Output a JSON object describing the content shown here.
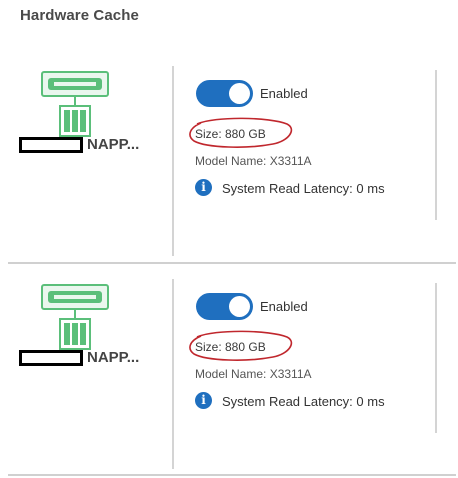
{
  "page": {
    "title": "Hardware Cache"
  },
  "colors": {
    "accent": "#1f6fbf",
    "node_green": "#5bbf7a",
    "annotation_red": "#c0272d"
  },
  "cards": [
    {
      "node_name": "NAPP...",
      "toggle_state": "on",
      "toggle_label": "Enabled",
      "size": "Size: 880 GB",
      "model": "Model Name: X3311A",
      "latency": "System Read Latency: 0 ms",
      "icons": {
        "node": "storage-node-icon",
        "info": "info-icon"
      }
    },
    {
      "node_name": "NAPP...",
      "toggle_state": "on",
      "toggle_label": "Enabled",
      "size": "Size: 880 GB",
      "model": "Model Name: X3311A",
      "latency": "System Read Latency: 0 ms",
      "icons": {
        "node": "storage-node-icon",
        "info": "info-icon"
      }
    }
  ]
}
